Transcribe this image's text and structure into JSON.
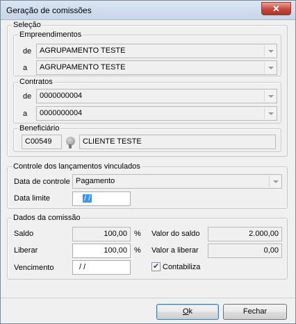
{
  "window": {
    "title": "Geração de comissões",
    "close_glyph": "✕"
  },
  "selecao": {
    "legend": "Seleção",
    "empreendimentos": {
      "legend": "Empreendimentos",
      "de_label": "de",
      "de_value": "AGRUPAMENTO TESTE",
      "a_label": "a",
      "a_value": "AGRUPAMENTO TESTE"
    },
    "contratos": {
      "legend": "Contratos",
      "de_label": "de",
      "de_value": "0000000004",
      "a_label": "a",
      "a_value": "0000000004"
    },
    "beneficiario": {
      "legend": "Beneficiário",
      "code": "C00549",
      "search_icon": "search-icon",
      "name": "CLIENTE TESTE"
    }
  },
  "controle": {
    "legend": "Controle dos lançamentos vinculados",
    "data_controle_label": "Data de controle",
    "data_controle_value": "Pagamento",
    "data_limite_label": "Data limite",
    "data_limite_value": " / /"
  },
  "dados": {
    "legend": "Dados da comissão",
    "saldo_label": "Saldo",
    "saldo_value": "100,00",
    "saldo_unit": "%",
    "liberar_label": "Liberar",
    "liberar_value": "100,00",
    "liberar_unit": "%",
    "vencimento_label": "Vencimento",
    "vencimento_value": " / /",
    "valor_saldo_label": "Valor do saldo",
    "valor_saldo_value": "2.000,00",
    "valor_liberar_label": "Valor a liberar",
    "valor_liberar_value": "0,00",
    "contabiliza_label": "Contabiliza",
    "contabiliza_checked": true
  },
  "footer": {
    "ok_accel": "O",
    "ok_rest": "k",
    "fechar_label": "Fechar"
  }
}
